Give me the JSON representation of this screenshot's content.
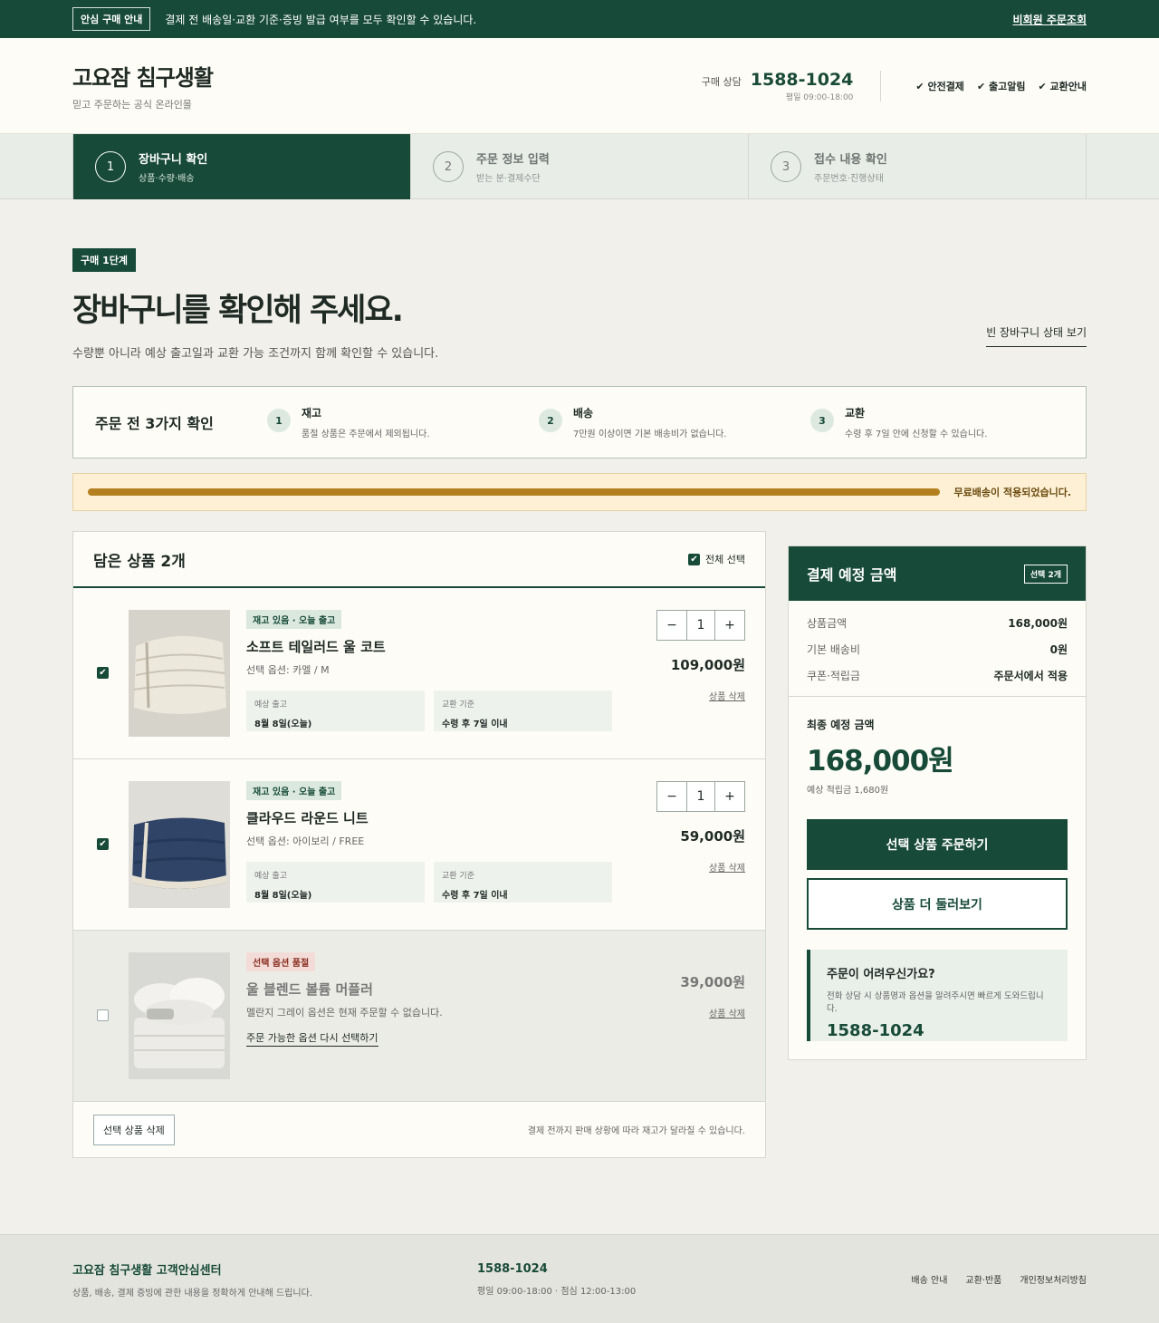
{
  "topbar": {
    "badge": "안심 구매 안내",
    "notice": "결제 전 배송일·교환 기준·증빙 발급 여부를 모두 확인할 수 있습니다.",
    "lookup": "비회원 주문조회"
  },
  "header": {
    "brand": "고요잠 침구생활",
    "tagline": "믿고 주문하는 공식 온라인몰",
    "phone_label": "구매 상담",
    "phone": "1588-1024",
    "hours": "평일 09:00-18:00",
    "assurances": [
      "✔ 안전결제",
      "✔ 출고알림",
      "✔ 교환안내"
    ]
  },
  "steps": [
    {
      "num": "1",
      "title": "장바구니 확인",
      "sub": "상품·수량·배송"
    },
    {
      "num": "2",
      "title": "주문 정보 입력",
      "sub": "받는 분·결제수단"
    },
    {
      "num": "3",
      "title": "접수 내용 확인",
      "sub": "주문번호·진행상태"
    }
  ],
  "intro": {
    "badge": "구매 1단계",
    "title": "장바구니를 확인해 주세요.",
    "desc": "수량뿐 아니라 예상 출고일과 교환 가능 조건까지 함께 확인할 수 있습니다.",
    "empty_link": "빈 장바구니 상태 보기"
  },
  "checklist": {
    "title": "주문 전 3가지 확인",
    "items": [
      {
        "n": "1",
        "h": "재고",
        "d": "품절 상품은 주문에서 제외됩니다."
      },
      {
        "n": "2",
        "h": "배송",
        "d": "7만원 이상이면 기본 배송비가 없습니다."
      },
      {
        "n": "3",
        "h": "교환",
        "d": "수령 후 7일 안에 신청할 수 있습니다."
      }
    ]
  },
  "shipping_progress": {
    "fraction": 1.0,
    "message": "무료배송이 적용되었습니다."
  },
  "cart": {
    "title": "담은 상품 2개",
    "select_all": "전체 선택",
    "items": [
      {
        "checked": true,
        "tag": "재고 있음 · 오늘 출고",
        "name": "소프트 테일러드 울 코트",
        "option": "선택 옵션: 카멜 / M",
        "ship_label": "예상 출고",
        "ship_value": "8월 8일(오늘)",
        "exchange_label": "교환 기준",
        "exchange_value": "수령 후 7일 이내",
        "qty": "1",
        "price": "109,000원",
        "delete": "상품 삭제"
      },
      {
        "checked": true,
        "tag": "재고 있음 · 오늘 출고",
        "name": "클라우드 라운드 니트",
        "option": "선택 옵션: 아이보리 / FREE",
        "ship_label": "예상 출고",
        "ship_value": "8월 8일(오늘)",
        "exchange_label": "교환 기준",
        "exchange_value": "수령 후 7일 이내",
        "qty": "1",
        "price": "59,000원",
        "delete": "상품 삭제"
      },
      {
        "checked": false,
        "tag": "선택 옵션 품절",
        "name": "울 블렌드 볼륨 머플러",
        "option": "멜란지 그레이 옵션은 현재 주문할 수 없습니다.",
        "relink": "주문 가능한 옵션 다시 선택하기",
        "price": "39,000원",
        "delete": "상품 삭제"
      }
    ],
    "qty_minus": "−",
    "qty_plus": "+",
    "delete_selected": "선택 상품 삭제",
    "foot_note": "결제 전까지 판매 상황에 따라 재고가 달라질 수 있습니다."
  },
  "summary": {
    "title": "결제 예정 금액",
    "chip": "선택 2개",
    "rows": [
      {
        "k": "상품금액",
        "v": "168,000원"
      },
      {
        "k": "기본 배송비",
        "v": "0원"
      },
      {
        "k": "쿠폰·적립금",
        "v": "주문서에서 적용"
      }
    ],
    "total_label": "최종 예정 금액",
    "total": "168,000원",
    "points": "예상 적립금 1,680원",
    "order_button": "선택 상품 주문하기",
    "browse_button": "상품 더 둘러보기",
    "help_title": "주문이 어려우신가요?",
    "help_desc": "전화 상담 시 상품명과 옵션을 알려주시면 빠르게 도와드립니다.",
    "help_phone": "1588-1024"
  },
  "footer": {
    "title": "고요잠 침구생활 고객안심센터",
    "desc": "상품, 배송, 결제 증빙에 관한 내용을 정확하게 안내해 드립니다.",
    "phone": "1588-1024",
    "hours": "평일 09:00-18:00 · 점심 12:00-13:00",
    "links": [
      "배송 안내",
      "교환·반품",
      "개인정보처리방침"
    ]
  }
}
